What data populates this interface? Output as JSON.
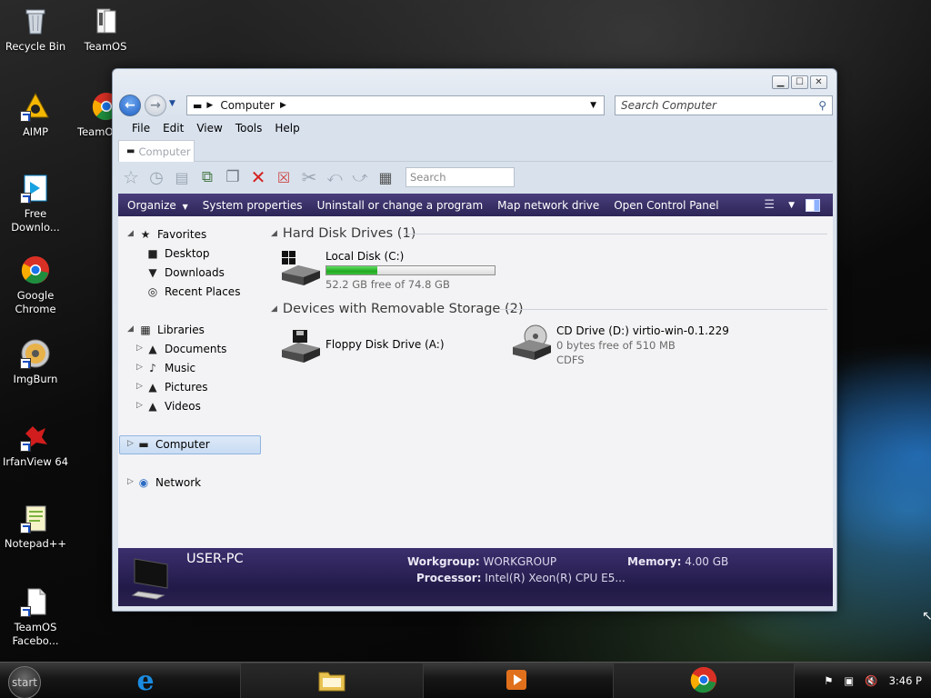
{
  "desktop": {
    "icons": [
      {
        "label": "Recycle Bin",
        "icon": "recycle-bin-icon"
      },
      {
        "label": "TeamOS",
        "icon": "folder-icon"
      },
      {
        "label": "AIMP",
        "icon": "aimp-icon"
      },
      {
        "label": "TeamO",
        "icon": "chrome-icon"
      },
      {
        "label": "Free Downlo...",
        "icon": "free-download-manager-icon"
      },
      {
        "label": "Google Chrome",
        "icon": "chrome-icon"
      },
      {
        "label": "ImgBurn",
        "icon": "imgburn-icon"
      },
      {
        "label": "IrfanView 64",
        "icon": "irfanview-icon"
      },
      {
        "label": "Notepad++",
        "icon": "notepad-plus-icon"
      },
      {
        "label": "TeamOS Facebo...",
        "icon": "document-icon"
      }
    ]
  },
  "window": {
    "address": {
      "path": "Computer"
    },
    "search_placeholder": "Search Computer",
    "menu": [
      "File",
      "Edit",
      "View",
      "Tools",
      "Help"
    ],
    "tab_label": "Computer",
    "toolbar_search_placeholder": "Search",
    "commands": [
      "Organize",
      "System properties",
      "Uninstall or change a program",
      "Map network drive",
      "Open Control Panel"
    ],
    "nav": {
      "favorites": "Favorites",
      "favorites_items": [
        "Desktop",
        "Downloads",
        "Recent Places"
      ],
      "libraries": "Libraries",
      "libraries_items": [
        "Documents",
        "Music",
        "Pictures",
        "Videos"
      ],
      "computer": "Computer",
      "network": "Network"
    },
    "groups": {
      "hdd": "Hard Disk Drives (1)",
      "removable": "Devices with Removable Storage (2)"
    },
    "drives": {
      "c": {
        "name": "Local Disk (C:)",
        "free_text": "52.2 GB free of 74.8 GB",
        "used_fraction": 0.302
      },
      "a": {
        "name": "Floppy Disk Drive (A:)"
      },
      "d": {
        "name": "CD Drive (D:) virtio-win-0.1.229",
        "free_text": "0 bytes free of 510 MB",
        "fs": "CDFS"
      }
    },
    "details": {
      "pc_name": "USER-PC",
      "workgroup_label": "Workgroup:",
      "workgroup": "WORKGROUP",
      "memory_label": "Memory:",
      "memory": "4.00 GB",
      "processor_label": "Processor:",
      "processor": "Intel(R) Xeon(R) CPU E5..."
    }
  },
  "taskbar": {
    "start_label": "start",
    "clock": "3:46 P"
  },
  "colors": {
    "cmdbar": "#2c2656",
    "details_bg": "#211a47",
    "progress": "#23a823",
    "selection": "#c8dcf3"
  }
}
